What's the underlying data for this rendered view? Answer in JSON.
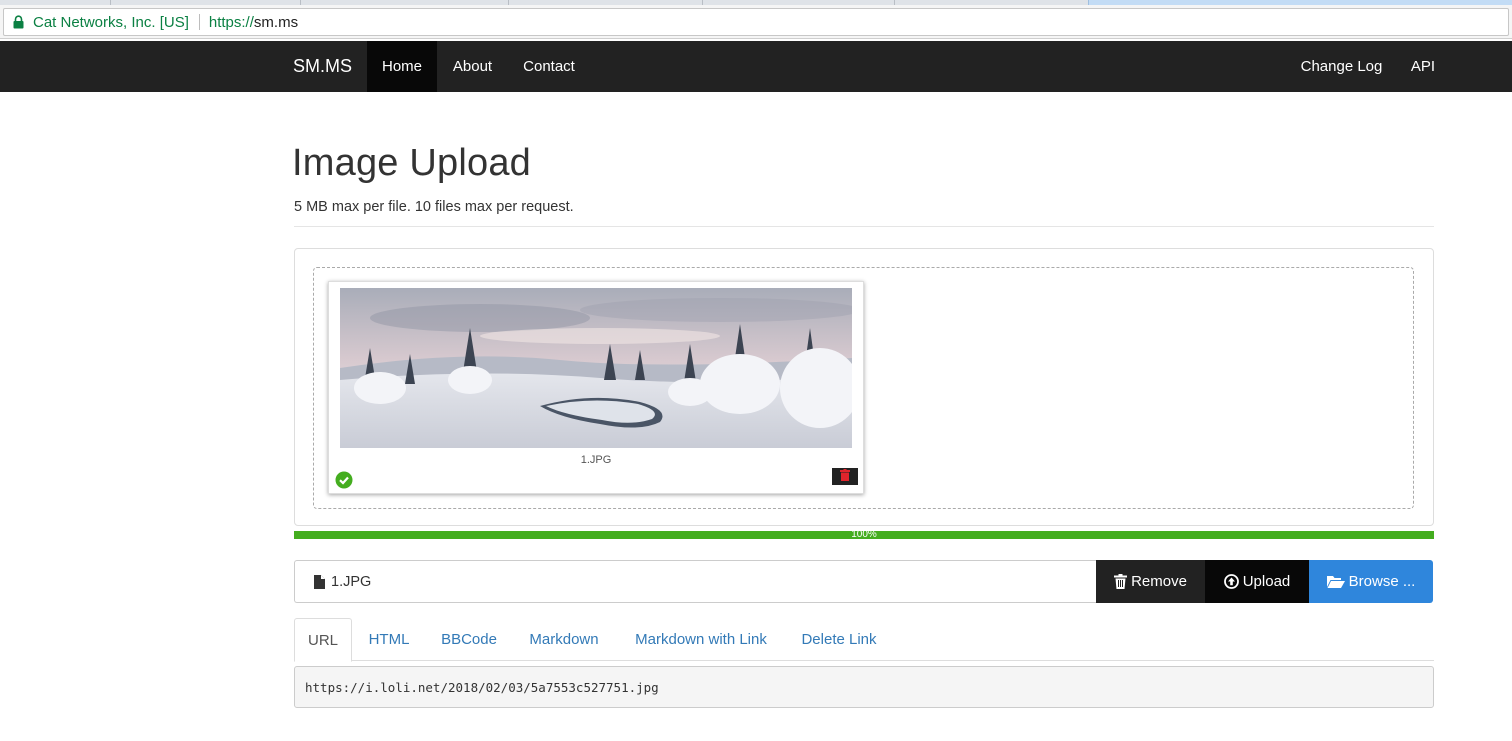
{
  "browser": {
    "security_label": "Cat Networks, Inc. [US]",
    "url_scheme": "https://",
    "url_host": "sm.ms"
  },
  "navbar": {
    "brand": "SM.MS",
    "left_items": [
      {
        "label": "Home",
        "active": true
      },
      {
        "label": "About",
        "active": false
      },
      {
        "label": "Contact",
        "active": false
      }
    ],
    "right_items": [
      {
        "label": "Change Log"
      },
      {
        "label": "API"
      }
    ]
  },
  "header": {
    "title": "Image Upload",
    "subtitle": "5 MB max per file. 10 files max per request."
  },
  "preview": {
    "filename": "1.JPG",
    "status": "uploaded",
    "success_icon": "check-circle-icon",
    "delete_icon": "trash-icon"
  },
  "progress": {
    "percent": 100,
    "label": "100%",
    "color": "#44ad1f"
  },
  "file_input": {
    "caption": "1.JPG",
    "remove_label": "Remove",
    "upload_label": "Upload",
    "browse_label": "Browse ..."
  },
  "result_tabs": [
    {
      "label": "URL",
      "active": true
    },
    {
      "label": "HTML",
      "active": false
    },
    {
      "label": "BBCode",
      "active": false
    },
    {
      "label": "Markdown",
      "active": false
    },
    {
      "label": "Markdown with Link",
      "active": false
    },
    {
      "label": "Delete Link",
      "active": false
    }
  ],
  "result": {
    "url": "https://i.loli.net/2018/02/03/5a7553c527751.jpg"
  },
  "colors": {
    "navbar_bg": "#222222",
    "browse_blue": "#2f86dc",
    "link_blue": "#337ab7",
    "progress_green": "#44ad1f",
    "secure_green": "#0b8043",
    "delete_red": "#e0242c"
  }
}
